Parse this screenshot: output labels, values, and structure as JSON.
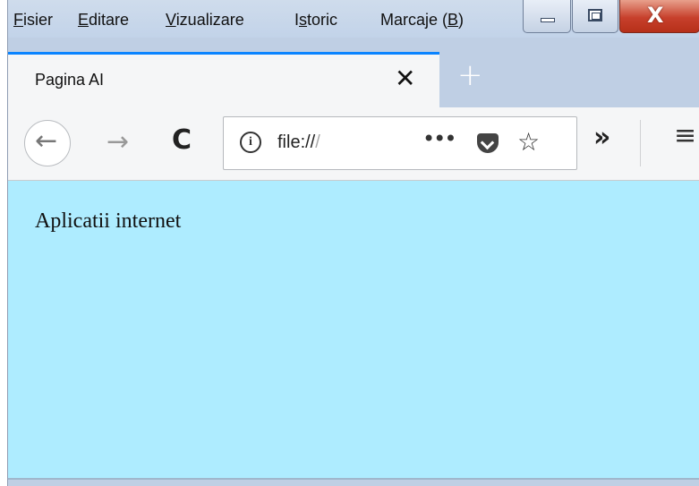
{
  "menubar": {
    "items": [
      {
        "mnemonic": "F",
        "rest": "isier"
      },
      {
        "mnemonic": "E",
        "rest": "ditare"
      },
      {
        "mnemonic": "V",
        "rest": "izualizare"
      },
      {
        "pre": "I",
        "mnemonic": "s",
        "rest": "toric"
      },
      {
        "pre": "Marcaje (",
        "mnemonic": "B",
        "rest": ")"
      }
    ]
  },
  "window_controls": {
    "close_glyph": "X"
  },
  "tab": {
    "title": "Pagina AI",
    "close_glyph": "✕",
    "new_tab_glyph": "+"
  },
  "navbar": {
    "back_glyph": "←",
    "forward_glyph": "→",
    "reload_glyph": "C",
    "info_glyph": "i",
    "url_prefix": "file://",
    "url_faded": "/",
    "more_glyph": "•••",
    "star_glyph": "☆",
    "overflow_glyph": "»",
    "menu_glyph": "≡"
  },
  "content": {
    "text": "Aplicatii internet"
  },
  "colors": {
    "page_background": "#aeecff",
    "tab_accent": "#0a84ff",
    "close_button": "#c7402c"
  }
}
